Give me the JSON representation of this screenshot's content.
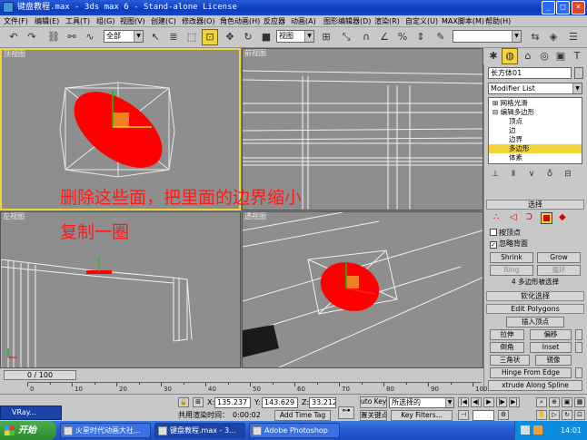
{
  "window": {
    "title": "键盘教程.max - 3ds max 6 - Stand-alone License"
  },
  "menu": [
    "文件(F)",
    "编辑(E)",
    "工具(T)",
    "组(G)",
    "视图(V)",
    "创建(C)",
    "修改器(O)",
    "角色动画(H)",
    "反应器",
    "动画(A)",
    "图形编辑器(D)",
    "渲染(R)",
    "自定义(U)",
    "MAX脚本(M)",
    "帮助(H)"
  ],
  "toolbar": {
    "selection_filter": "全部",
    "ref_coord": "视图"
  },
  "viewports": {
    "top": "顶视图",
    "front": "前视图",
    "left": "左视图",
    "perspective": "透视图"
  },
  "annotation": {
    "line1": "删除这些面，把里面的边界缩小",
    "line2": "复制一圈"
  },
  "command_panel": {
    "object_name": "长方体01",
    "modifier_list": "Modifier List",
    "stack": [
      {
        "label": "网格光滑",
        "selected": false
      },
      {
        "label": "编辑多边形",
        "selected": false
      },
      {
        "label": "顶点",
        "selected": false
      },
      {
        "label": "边",
        "selected": false
      },
      {
        "label": "边界",
        "selected": false
      },
      {
        "label": "多边形",
        "selected": true
      },
      {
        "label": "体素",
        "selected": false
      }
    ],
    "selection_rollout": "选择",
    "by_vertex": "按顶点",
    "ignore_backfacing": "忽略背面",
    "shrink": "Shrink",
    "grow": "Grow",
    "ring": "Ring",
    "loop": "循环",
    "selected_info": "4 多边形被选择",
    "soft_selection": "软化选择",
    "edit_polygons": "Edit Polygons",
    "insert_vertex": "插入顶点",
    "extrude": "拉伸",
    "outline": "偏移",
    "bevel": "倒角",
    "inset": "Inset",
    "triangulate": "三角状",
    "flip": "镜像",
    "hinge": "Hinge From Edge",
    "extrude_spline": "xtrude Along Spline"
  },
  "timeline": {
    "frame": "0 / 100",
    "ticks": [
      "0",
      "10",
      "20",
      "30",
      "40",
      "50",
      "60",
      "70",
      "80",
      "90",
      "100"
    ]
  },
  "status": {
    "x_label": "X:",
    "x_value": "135.237",
    "y_label": "Y:",
    "y_value": "143.629",
    "z_label": "Z:",
    "z_value": "33.212",
    "auto_key": "uto Key",
    "key_mode": "所选择的",
    "set_key": "置关键点",
    "key_filters": "Key Filters...",
    "render_time_label": "共用渲染时间：",
    "render_time": "0:00:02",
    "add_time_tag": "Add Time Tag",
    "vray": "VRay..."
  },
  "taskbar": {
    "start": "开始",
    "tasks": [
      "火星时代动画大社...",
      "键盘教程.max - 3...",
      "Adobe Photoshop"
    ],
    "clock": "14:01"
  },
  "colors": {
    "highlight": "#f2d33a",
    "object": "#ff0000",
    "annotation": "#ff1a1a",
    "viewport_bg": "#8e8e8e",
    "taskbar": "#245ad2"
  }
}
